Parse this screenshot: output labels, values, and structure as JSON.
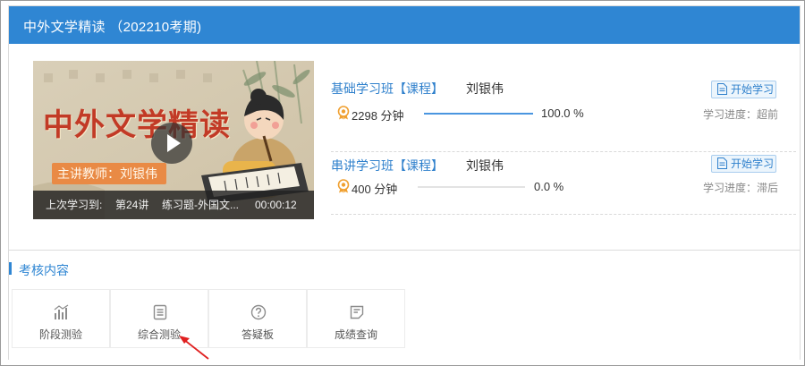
{
  "course": {
    "title": "中外文学精读 （202210考期)",
    "cover": {
      "title": "中外文学精读",
      "teacher_tag": "主讲教师：刘银伟",
      "last_study_label": "上次学习到:",
      "last_lesson": "第24讲",
      "last_topic": "练习题-外国文...",
      "last_time": "00:00:12"
    },
    "modules": [
      {
        "name": "基础学习班【课程】",
        "teacher": "刘银伟",
        "minutes": "2298 分钟",
        "progress": 1.0,
        "percent_text": "100.0 %",
        "start_label": "开始学习",
        "status_text": "学习进度：超前"
      },
      {
        "name": "串讲学习班【课程】",
        "teacher": "刘银伟",
        "minutes": "400 分钟",
        "progress": 0.0,
        "percent_text": "0.0 %",
        "start_label": "开始学习",
        "status_text": "学习进度：滞后"
      }
    ]
  },
  "exam": {
    "section_title": "考核内容",
    "tools": [
      {
        "label": "阶段测验",
        "icon": "bar-chart-icon"
      },
      {
        "label": "综合测验",
        "icon": "document-list-icon"
      },
      {
        "label": "答疑板",
        "icon": "question-circle-icon"
      },
      {
        "label": "成绩查询",
        "icon": "score-note-icon"
      }
    ]
  },
  "colors": {
    "header_blue": "#2f86d3",
    "link_blue": "#2f80cc",
    "progress_fill": "#4a96e0",
    "cover_title_red": "#c23a26",
    "annotation_arrow": "#e02020"
  }
}
